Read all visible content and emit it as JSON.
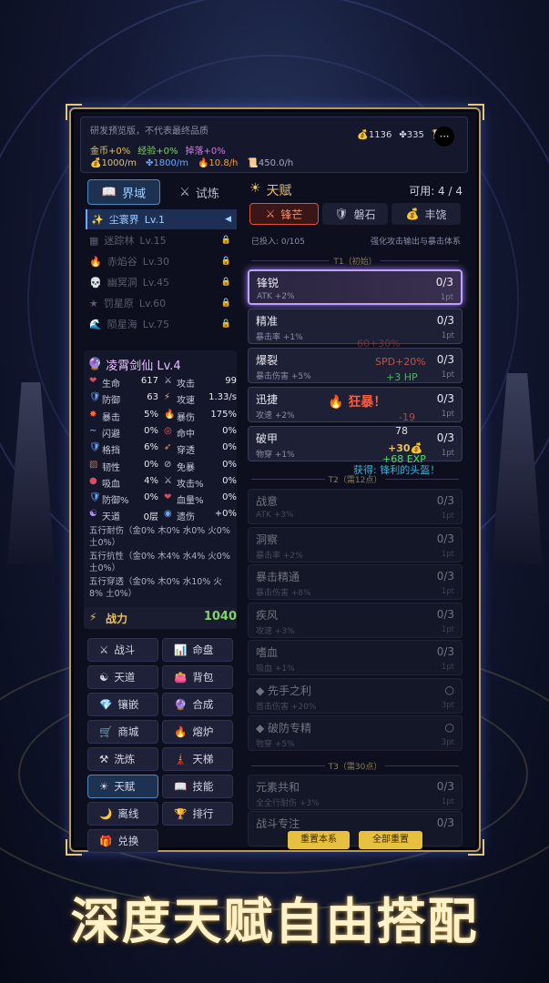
{
  "header": {
    "version_note": "研发预览版，不代表最终品质",
    "resources": [
      {
        "icon": "money-bag-icon",
        "value": "1136"
      },
      {
        "icon": "crystal-icon",
        "value": "335"
      },
      {
        "icon": "scroll-icon",
        "value": "40"
      }
    ],
    "bonuses": [
      {
        "text": "金币+0%",
        "color": "#e8c060"
      },
      {
        "text": "经验+0%",
        "color": "#7fd36a"
      },
      {
        "text": "掉落+0%",
        "color": "#d873e8"
      }
    ],
    "rates": [
      {
        "text": "1000/m",
        "color": "#e8c060"
      },
      {
        "text": "1800/m",
        "color": "#6aa8ff"
      },
      {
        "text": "10.8/h",
        "color": "#ff9d3a"
      },
      {
        "text": "450.0/h",
        "color": "#a8a8c0"
      }
    ]
  },
  "left_tabs": [
    {
      "label": "界域",
      "icon": "book-icon",
      "active": true
    },
    {
      "label": "试炼",
      "icon": "swords-icon",
      "active": false
    }
  ],
  "realms": [
    {
      "label": "尘寰界",
      "level": "Lv.1",
      "icon": "sparkle-icon",
      "active": true
    },
    {
      "label": "迷踪林",
      "level": "Lv.15",
      "icon": "stone-icon"
    },
    {
      "label": "赤焰谷",
      "level": "Lv.30",
      "icon": "flame-icon"
    },
    {
      "label": "幽冥洞",
      "level": "Lv.45",
      "icon": "skull-icon"
    },
    {
      "label": "罚星原",
      "level": "Lv.60",
      "icon": "star-icon"
    },
    {
      "label": "陨星海",
      "level": "Lv.75",
      "icon": "wave-icon"
    }
  ],
  "character": {
    "name": "凌霄剑仙 Lv.4",
    "stats": [
      [
        "生命",
        "617",
        "攻击",
        "99"
      ],
      [
        "防御",
        "63",
        "攻速",
        "1.33/s"
      ],
      [
        "暴击",
        "5%",
        "暴伤",
        "175%"
      ],
      [
        "闪避",
        "0%",
        "命中",
        "0%"
      ],
      [
        "格挡",
        "6%",
        "穿透",
        "0%"
      ],
      [
        "韧性",
        "0%",
        "免暴",
        "0%"
      ],
      [
        "吸血",
        "4%",
        "攻击%",
        "0%"
      ],
      [
        "防御%",
        "0%",
        "血量%",
        "0%"
      ],
      [
        "天道",
        "0层",
        "遗伤",
        "+0%"
      ]
    ],
    "elements": [
      {
        "label": "五行耐伤",
        "values": "（金0% 木0% 水0% 火0% 土0%）"
      },
      {
        "label": "五行抗性",
        "values": "（金0% 木4% 水4% 火0% 土0%）"
      },
      {
        "label": "五行穿透",
        "values": "（金0% 木0% 水10% 火8% 土0%）"
      }
    ],
    "power_label": "战力",
    "power": "1040"
  },
  "nav": [
    {
      "label": "战斗",
      "icon": "swords-icon"
    },
    {
      "label": "命盘",
      "icon": "chart-icon"
    },
    {
      "label": "天道",
      "icon": "taiji-icon"
    },
    {
      "label": "背包",
      "icon": "bag-icon"
    },
    {
      "label": "镶嵌",
      "icon": "gem-icon"
    },
    {
      "label": "合成",
      "icon": "orb-icon"
    },
    {
      "label": "商城",
      "icon": "cart-icon"
    },
    {
      "label": "熔炉",
      "icon": "furnace-icon"
    },
    {
      "label": "洗炼",
      "icon": "anvil-icon"
    },
    {
      "label": "天梯",
      "icon": "tower-icon"
    },
    {
      "label": "天赋",
      "icon": "sun-icon",
      "active": true
    },
    {
      "label": "技能",
      "icon": "book-icon"
    },
    {
      "label": "离线",
      "icon": "moon-icon"
    },
    {
      "label": "排行",
      "icon": "trophy-icon"
    },
    {
      "label": "兑换",
      "icon": "gift-icon"
    }
  ],
  "talent": {
    "title": "天赋",
    "available": "可用: 4 / 4",
    "tabs": [
      {
        "label": "锋芒",
        "active": true
      },
      {
        "label": "磐石"
      },
      {
        "label": "丰饶"
      }
    ],
    "invested": "已投入: 0/105",
    "desc": "强化攻击输出与暴击体系",
    "tier1": "T1（初始）",
    "tier2": "T2（需12点）",
    "tier3": "T3（需30点）",
    "t1": [
      {
        "name": "锋锐",
        "desc": "ATK +2%",
        "count": "0/3",
        "pt": "1pt"
      },
      {
        "name": "精准",
        "desc": "暴击率 +1%",
        "count": "0/3",
        "pt": "1pt"
      },
      {
        "name": "爆裂",
        "desc": "暴击伤害 +5%",
        "count": "0/3",
        "pt": "1pt"
      },
      {
        "name": "迅捷",
        "desc": "攻速 +2%",
        "count": "0/3",
        "pt": "1pt"
      },
      {
        "name": "破甲",
        "desc": "物穿 +1%",
        "count": "0/3",
        "pt": "1pt"
      }
    ],
    "t2": [
      {
        "name": "战意",
        "desc": "ATK +3%",
        "count": "0/3",
        "pt": "1pt"
      },
      {
        "name": "洞察",
        "desc": "暴击率 +2%",
        "count": "0/3",
        "pt": "1pt"
      },
      {
        "name": "暴击精通",
        "desc": "暴击伤害 +8%",
        "count": "0/3",
        "pt": "1pt"
      },
      {
        "name": "疾风",
        "desc": "攻速 +3%",
        "count": "0/3",
        "pt": "1pt"
      },
      {
        "name": "嗜血",
        "desc": "吸血 +1%",
        "count": "0/3",
        "pt": "1pt"
      },
      {
        "name": "◆ 先手之利",
        "desc": "首击伤害 +20%",
        "count": "○",
        "pt": "3pt"
      },
      {
        "name": "◆ 破防专精",
        "desc": "物穿 +5%",
        "count": "○",
        "pt": "3pt"
      }
    ],
    "t3": [
      {
        "name": "元素共和",
        "desc": "全全行耐伤 +3%",
        "count": "0/3",
        "pt": "1pt"
      },
      {
        "name": "战斗专注",
        "desc": "",
        "count": "0/3",
        "pt": ""
      }
    ],
    "reset_page": "重置本系",
    "reset_all": "全部重置"
  },
  "floating": {
    "crit": "狂暴！",
    "gold": "+30",
    "exp": "+68 EXP",
    "hp": "+3 HP",
    "spd": "SPD+20%",
    "dmg": "-19",
    "num": "78",
    "loot": "获得: 锋利的头盔！",
    "loot2": "60+30%"
  },
  "banner": "深度天赋自由搭配"
}
